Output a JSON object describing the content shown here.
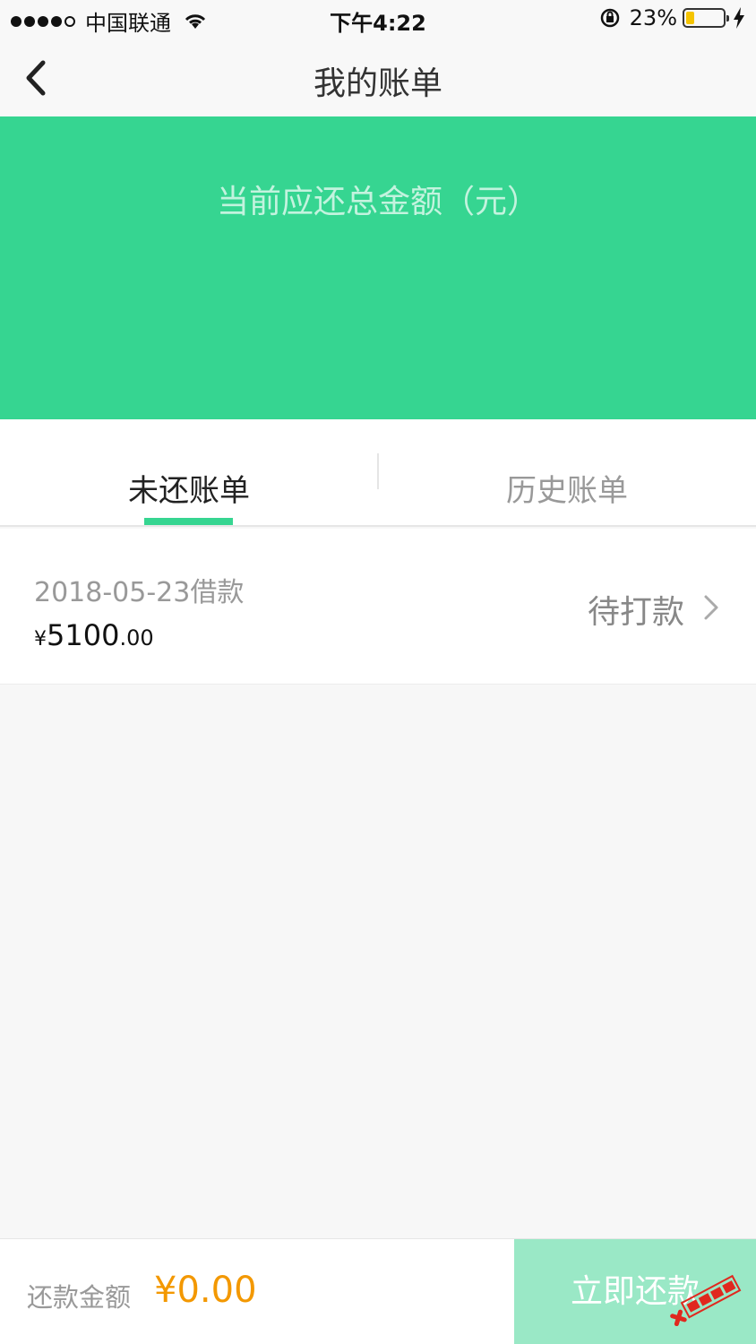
{
  "status_bar": {
    "carrier": "中国联通",
    "time": "下午4:22",
    "battery_percent": "23%",
    "battery_level": 0.23,
    "battery_color": "#f5c400"
  },
  "nav": {
    "title": "我的账单",
    "back_icon": "chevron-left-icon"
  },
  "hero": {
    "label": "当前应还总金额（元）",
    "background": "#36d591"
  },
  "tabs": [
    {
      "label": "未还账单",
      "active": true
    },
    {
      "label": "历史账单",
      "active": false
    }
  ],
  "bills": [
    {
      "date_label": "2018-05-23借款",
      "amount_currency": "¥",
      "amount_integer": "5100",
      "amount_decimal": ".00",
      "status": "待打款"
    }
  ],
  "footer": {
    "repay_label": "还款金额",
    "repay_value": "¥0.00",
    "pay_button": "立即还款",
    "accent_color": "#f39800"
  }
}
